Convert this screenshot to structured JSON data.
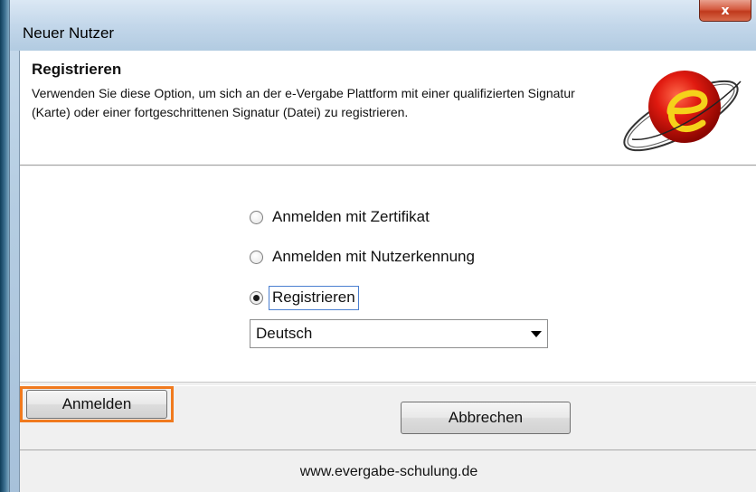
{
  "window": {
    "title": "Neuer Nutzer",
    "close_glyph": "x"
  },
  "header": {
    "title": "Registrieren",
    "description": "Verwenden Sie diese Option, um sich an der e-Vergabe Plattform mit einer qualifizierten Signatur (Karte) oder einer fortgeschrittenen Signatur (Datei) zu registrieren.",
    "logo_icon": "e-vergabe-logo-icon"
  },
  "options": [
    {
      "label": "Anmelden mit Zertifikat",
      "checked": false
    },
    {
      "label": "Anmelden mit Nutzerkennung",
      "checked": false
    },
    {
      "label": "Registrieren",
      "checked": true
    }
  ],
  "language_select": {
    "selected": "Deutsch"
  },
  "buttons": {
    "cancel_label": "Abbrechen",
    "login_label": "Anmelden"
  },
  "footer": {
    "url": "www.evergabe-schulung.de"
  },
  "colors": {
    "highlight": "#f07a1e",
    "close_button": "#c0391c"
  }
}
